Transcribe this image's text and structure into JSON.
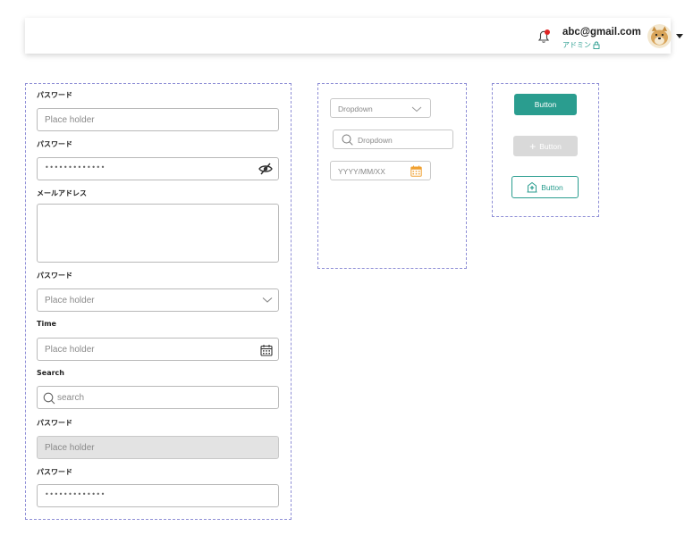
{
  "header": {
    "email": "abc@gmail.com",
    "role": "アドミン",
    "icons": {
      "bell": "bell-icon",
      "lock": "lock-icon",
      "avatar": "avatar",
      "caret": "caret-down-icon"
    },
    "notification_color": "#e02424"
  },
  "form": {
    "fields": [
      {
        "label": "パスワード",
        "placeholder": "Place holder"
      },
      {
        "label": "パスワード",
        "value": "•••••••••••••"
      },
      {
        "label": "メールアドレス",
        "value": ""
      },
      {
        "label": "パスワード",
        "placeholder": "Place holder"
      },
      {
        "label": "Time",
        "placeholder": "Place holder"
      },
      {
        "label": "Search",
        "placeholder": "search"
      },
      {
        "label": "パスワード",
        "placeholder": "Place holder"
      },
      {
        "label": "パスワード",
        "value": "•••••••••••••"
      }
    ]
  },
  "middle": {
    "dropdown": "Dropdown",
    "search_dropdown": "Dropdown",
    "date": "YYYY/MM/XX"
  },
  "buttons": {
    "primary": "Button",
    "disabled": "Button",
    "outline": "Button"
  },
  "colors": {
    "accent": "#2a9d8f",
    "panel_border": "#8f8fd6",
    "calendar": "#f0a030"
  }
}
